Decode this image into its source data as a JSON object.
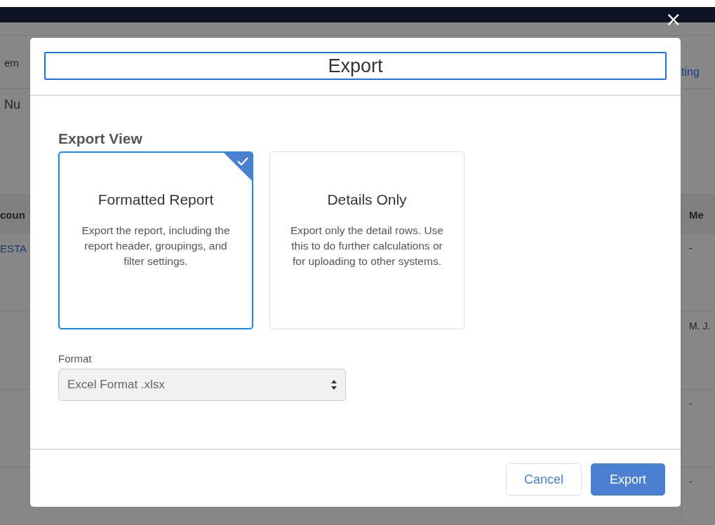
{
  "background_rows": [
    {
      "kind": "toolbar",
      "left": {
        "text": "em",
        "kind": "plain"
      },
      "right": {
        "text": "ting",
        "kind": "link"
      }
    },
    {
      "kind": "subbar",
      "left": {
        "text": "Nu",
        "kind": "plain"
      }
    },
    {
      "kind": "header",
      "left": {
        "text": "coun",
        "kind": "plain"
      },
      "right": {
        "text": "Me",
        "kind": "plain"
      }
    },
    {
      "kind": "data",
      "left": {
        "text": "ESTA",
        "kind": "link"
      },
      "right": {
        "text": "-",
        "kind": "plain"
      }
    },
    {
      "kind": "data",
      "right": {
        "text": "M. J.",
        "kind": "plain"
      }
    },
    {
      "kind": "data",
      "right": {
        "text": "-",
        "kind": "plain"
      }
    },
    {
      "kind": "data",
      "right": {
        "text": "-",
        "kind": "plain"
      }
    }
  ],
  "close_label": "×",
  "dialog": {
    "title": "Export",
    "section_label": "Export View",
    "options": [
      {
        "title": "Formatted Report",
        "description": "Export the report, including the report header, groupings, and filter settings.",
        "selected": true
      },
      {
        "title": "Details Only",
        "description": "Export only the detail rows. Use this to do further calculations or for uploading to other systems.",
        "selected": false
      }
    ],
    "format": {
      "label": "Format",
      "value": "Excel Format .xlsx"
    },
    "buttons": [
      {
        "label": "Cancel",
        "kind": "secondary"
      },
      {
        "label": "Export",
        "kind": "primary"
      }
    ]
  }
}
